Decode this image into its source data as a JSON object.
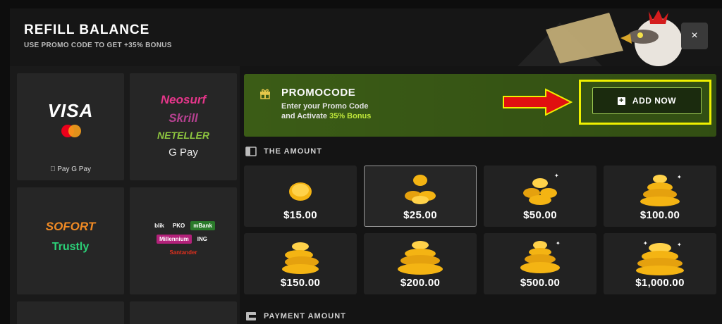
{
  "header": {
    "title": "REFILL BALANCE",
    "subtitle": "USE PROMO CODE TO GET +35% BONUS",
    "close_label": "×"
  },
  "payment_methods": {
    "card": {
      "brand": "VISA",
      "wallets": " Pay  G Pay"
    },
    "ewallets": {
      "lines": [
        "Neosurf",
        "Skrill",
        "NETELLER",
        "G Pay"
      ]
    },
    "bank_transfer": {
      "lines": [
        "SOFORT",
        "Trustly"
      ]
    },
    "banks": {
      "logos": [
        "blik",
        "PKO",
        "mBank",
        "Millennium",
        "ING",
        "Santander"
      ]
    }
  },
  "promo": {
    "title": "PROMOCODE",
    "desc_line1": "Enter your Promo Code",
    "desc_line2_prefix": "and Activate",
    "desc_line2_bonus": "35% Bonus",
    "button_label": "ADD NOW",
    "accent_color": "#c6ef3c",
    "highlight_color": "#f0f000",
    "arrow_color": "#e01010"
  },
  "amount_section": {
    "title": "THE AMOUNT",
    "selected_index": 1,
    "options": [
      {
        "label": "$15.00",
        "icon": "single-coin-icon"
      },
      {
        "label": "$25.00",
        "icon": "coin-pile-icon"
      },
      {
        "label": "$50.00",
        "icon": "coin-pile-icon"
      },
      {
        "label": "$100.00",
        "icon": "coin-pile-icon"
      },
      {
        "label": "$150.00",
        "icon": "coin-stack-icon"
      },
      {
        "label": "$200.00",
        "icon": "coin-stack-icon"
      },
      {
        "label": "$500.00",
        "icon": "coin-stack-icon"
      },
      {
        "label": "$1,000.00",
        "icon": "coin-heap-icon"
      }
    ]
  },
  "payment_section": {
    "title": "PAYMENT AMOUNT"
  }
}
